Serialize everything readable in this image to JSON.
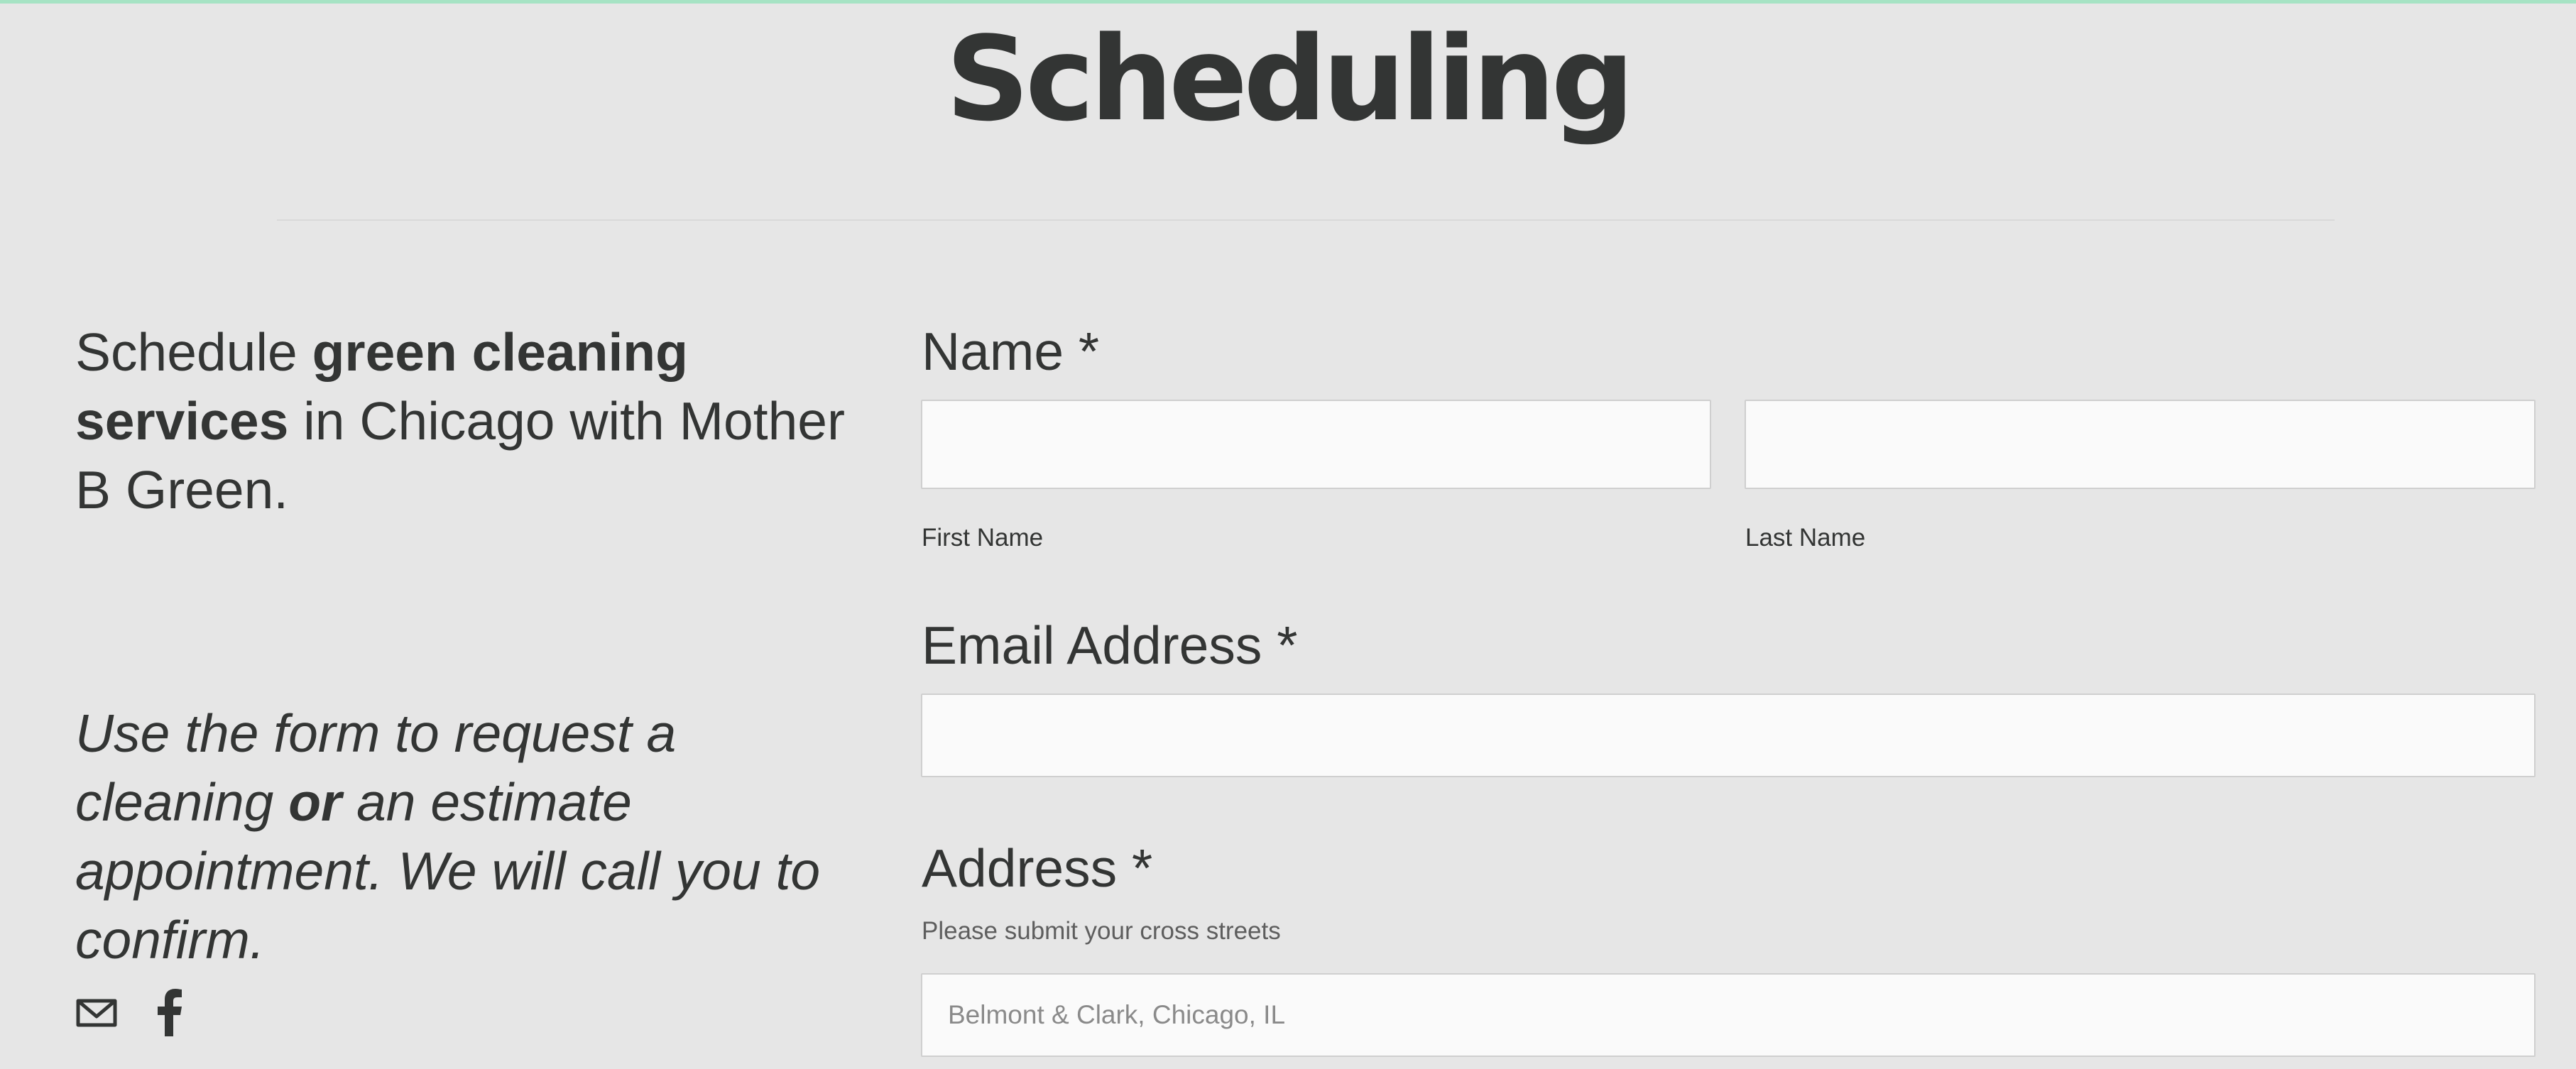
{
  "theme": {
    "accent": "#a6e3c4",
    "background": "#e6e6e6",
    "text": "#333534"
  },
  "page": {
    "title": "Scheduling"
  },
  "intro": {
    "part1": "Schedule ",
    "bold": "green cleaning services",
    "part2": " in Chicago with Mother B Green."
  },
  "note": {
    "part1": "Use the form to request a cleaning ",
    "bold": "or",
    "part2": " an estimate appointment. We will call you to confirm."
  },
  "social": {
    "icons": [
      "mail-icon",
      "facebook-icon"
    ]
  },
  "form": {
    "name": {
      "label": "Name *",
      "first_label": "First Name",
      "last_label": "Last Name",
      "first_value": "",
      "last_value": ""
    },
    "email": {
      "label": "Email Address *",
      "value": ""
    },
    "address": {
      "label": "Address *",
      "hint": "Please submit your cross streets",
      "placeholder": "Belmont & Clark, Chicago, IL",
      "value": ""
    }
  }
}
